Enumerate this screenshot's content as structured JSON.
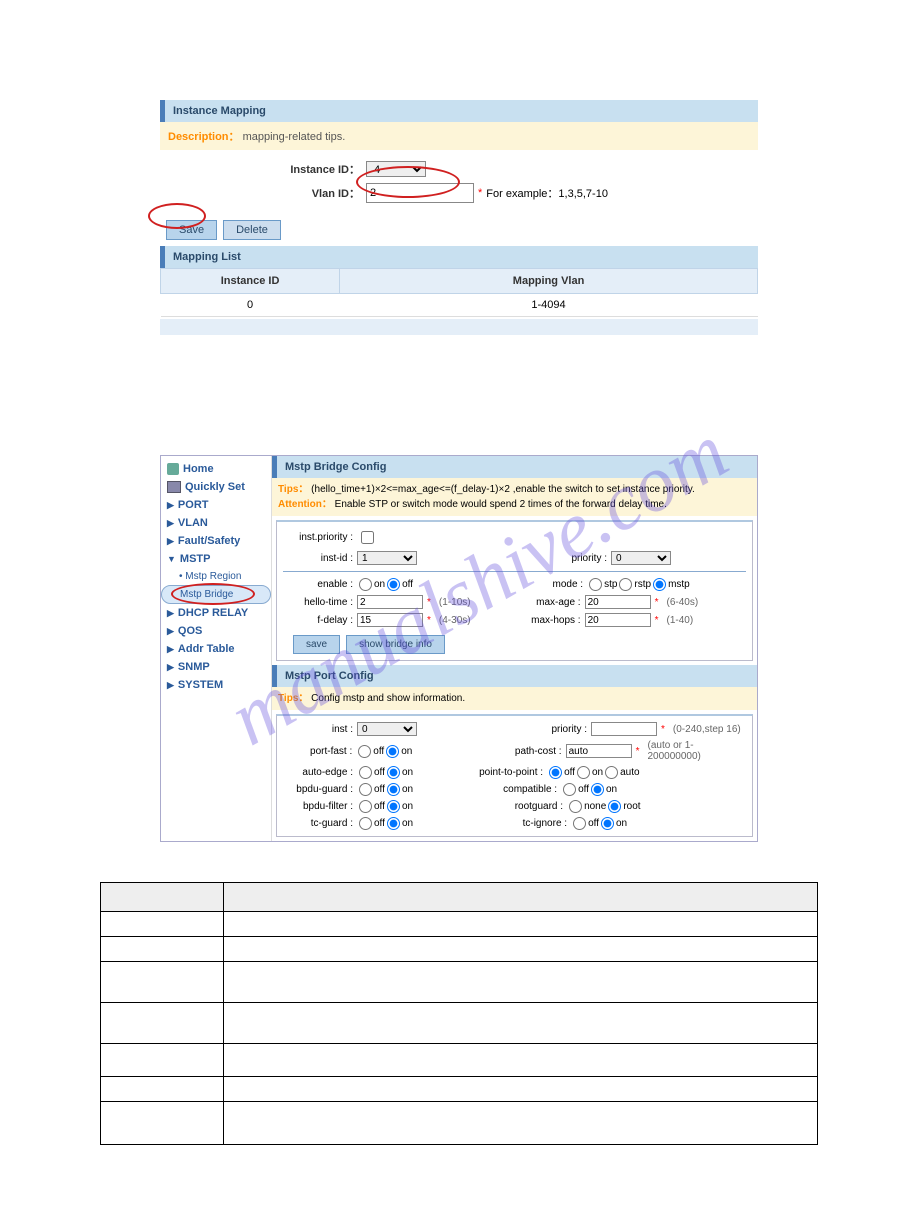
{
  "section1": {
    "panel_title": "Instance Mapping",
    "desc_label": "Description：",
    "desc_text": "mapping-related tips.",
    "instance_id_label": "Instance ID：",
    "instance_id_value": "4",
    "vlan_id_label": "Vlan ID：",
    "vlan_id_value": "2",
    "vlan_hint": "For example：1,3,5,7-10",
    "save_btn": "Save",
    "delete_btn": "Delete",
    "mapping_list_title": "Mapping List",
    "col_instance": "Instance ID",
    "col_vlan": "Mapping Vlan",
    "row": {
      "instance": "0",
      "vlan": "1-4094"
    }
  },
  "sidebar": {
    "home": "Home",
    "quickly": "Quickly Set",
    "items": [
      "PORT",
      "VLAN",
      "Fault/Safety",
      "MSTP",
      "DHCP RELAY",
      "QOS",
      "Addr Table",
      "SNMP",
      "SYSTEM"
    ],
    "mstp_sub": [
      "Mstp Region",
      "Mstp Bridge"
    ]
  },
  "bridge": {
    "panel_title": "Mstp Bridge Config",
    "tips_label": "Tips：",
    "tips_text": "(hello_time+1)×2<=max_age<=(f_delay-1)×2 ,enable the switch to set instance priority.",
    "att_label": "Attention：",
    "att_text": "Enable STP or switch mode would spend 2 times of the forward delay time.",
    "inst_priority_label": "inst.priority :",
    "inst_id_label": "inst-id :",
    "inst_id_value": "1",
    "priority_label": "priority :",
    "priority_value": "0",
    "enable_label": "enable :",
    "on": "on",
    "off": "off",
    "mode_label": "mode :",
    "mode_stp": "stp",
    "mode_rstp": "rstp",
    "mode_mstp": "mstp",
    "hello_label": "hello-time :",
    "hello_value": "2",
    "hello_hint": "(1-10s)",
    "maxage_label": "max-age :",
    "maxage_value": "20",
    "maxage_hint": "(6-40s)",
    "fdelay_label": "f-delay :",
    "fdelay_value": "15",
    "fdelay_hint": "(4-30s)",
    "maxhops_label": "max-hops :",
    "maxhops_value": "20",
    "maxhops_hint": "(1-40)",
    "save_btn": "save",
    "show_btn": "show bridge info"
  },
  "port": {
    "panel_title": "Mstp Port Config",
    "tips_label": "Tips：",
    "tips_text": "Config mstp and show information.",
    "inst_label": "inst :",
    "inst_value": "0",
    "priority_label": "priority :",
    "priority_hint": "(0-240,step 16)",
    "portfast_label": "port-fast :",
    "pathcost_label": "path-cost :",
    "pathcost_value": "auto",
    "pathcost_hint": "(auto or 1-200000000)",
    "autoedge_label": "auto-edge :",
    "p2p_label": "point-to-point :",
    "auto": "auto",
    "bpduguard_label": "bpdu-guard :",
    "compatible_label": "compatible :",
    "bpdufilter_label": "bpdu-filter :",
    "rootguard_label": "rootguard :",
    "none": "none",
    "root": "root",
    "tcguard_label": "tc-guard :",
    "tcignore_label": "tc-ignore :",
    "on": "on",
    "off": "off"
  },
  "watermark": "manualshive.com"
}
